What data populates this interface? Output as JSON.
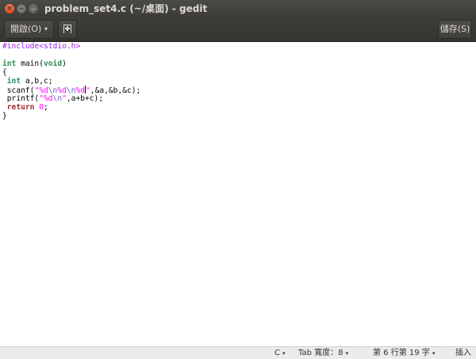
{
  "window": {
    "title": "problem_set4.c (~/桌面) - gedit",
    "close_glyph": "×",
    "min_glyph": "−",
    "max_glyph": "□"
  },
  "headerbar": {
    "open_label": "開啟(O)",
    "dropdown_glyph": "▾",
    "save_label": "儲存(S)"
  },
  "editor": {
    "lines": [
      {
        "t1": "#include<stdio.h>"
      },
      {},
      {
        "t1": "int",
        "t2": " main(",
        "t3": "void",
        "t4": ")"
      },
      {
        "t1": "{"
      },
      {
        "t1": " ",
        "t2": "int",
        "t3": " a,b,c;"
      },
      {
        "t1": " scanf(",
        "t2": "\"%d",
        "t3": "\\n",
        "t4": "%d",
        "t5": "\\n",
        "t6": "%d",
        "t7": "\"",
        "t8": ",&a,&b,&c);"
      },
      {
        "t1": " printf(",
        "t2": "\"%d",
        "t3": "\\n",
        "t4": "\"",
        "t5": ",a+b+c);"
      },
      {
        "t1": " ",
        "t2": "return",
        "t3": " ",
        "t4": "0",
        "t5": ";"
      },
      {
        "t1": "}"
      }
    ]
  },
  "statusbar": {
    "language": "C",
    "tab_width": "Tab 寬度：8",
    "position": "第 6 行第 19 字",
    "mode": "插入"
  }
}
